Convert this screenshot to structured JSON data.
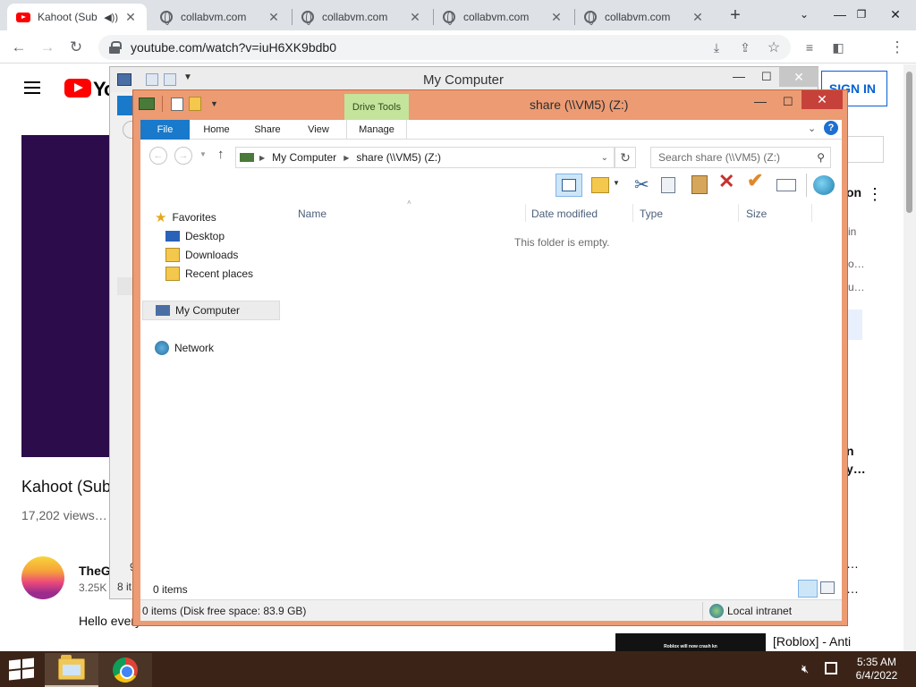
{
  "browser": {
    "tabs": [
      {
        "title": "Kahoot (Sub",
        "favicon": "youtube-icon",
        "audio": true,
        "active": true
      },
      {
        "title": "collabvm.com",
        "favicon": "globe-icon",
        "active": false
      },
      {
        "title": "collabvm.com",
        "favicon": "globe-icon",
        "active": false
      },
      {
        "title": "collabvm.com",
        "favicon": "globe-icon",
        "active": false
      },
      {
        "title": "collabvm.com",
        "favicon": "globe-icon",
        "active": false
      }
    ],
    "new_tab_symbol": "+",
    "url": "youtube.com/watch?v=iuH6XK9bdb0"
  },
  "youtube": {
    "logo_text": "Yo",
    "sign_in": "SIGN IN",
    "video_title": "Kahoot (Sub",
    "views": "17,202 views…",
    "channel_name": "TheG",
    "subscribers": "3.25K",
    "description_start": "Hello every",
    "sidebar_fragments": [
      "on",
      "in",
      "o…",
      "u…",
      "n",
      "y…",
      "…",
      "…"
    ],
    "up_next_title": "[Roblox] - Anti",
    "thumb_caption": "Roblox will now crash kn"
  },
  "mycomputer": {
    "title": "My Computer",
    "status_count": "8 it",
    "status_num": "9"
  },
  "explorer": {
    "title": "share (\\\\VM5) (Z:)",
    "context_tab": "Drive Tools",
    "ribbon_tabs": [
      "File",
      "Home",
      "Share",
      "View",
      "Manage"
    ],
    "breadcrumb": [
      "My Computer",
      "share (\\\\VM5) (Z:)"
    ],
    "search_placeholder": "Search share (\\\\VM5) (Z:)",
    "nav": {
      "favorites": "Favorites",
      "desktop": "Desktop",
      "downloads": "Downloads",
      "recent": "Recent places",
      "computer": "My Computer",
      "network": "Network"
    },
    "columns": [
      "Name",
      "Date modified",
      "Type",
      "Size"
    ],
    "empty_message": "This folder is empty.",
    "item_count": "0 items",
    "status_bar": "0 items (Disk free space: 83.9 GB)",
    "zone": "Local intranet"
  },
  "taskbar": {
    "time": "5:35 AM",
    "date": "6/4/2022"
  },
  "colors": {
    "window_frame": "#ec9b73",
    "file_tab": "#1979ca",
    "drive_tools": "#c4e39b",
    "taskbar": "#3b2417",
    "youtube_red": "#ff0000"
  }
}
